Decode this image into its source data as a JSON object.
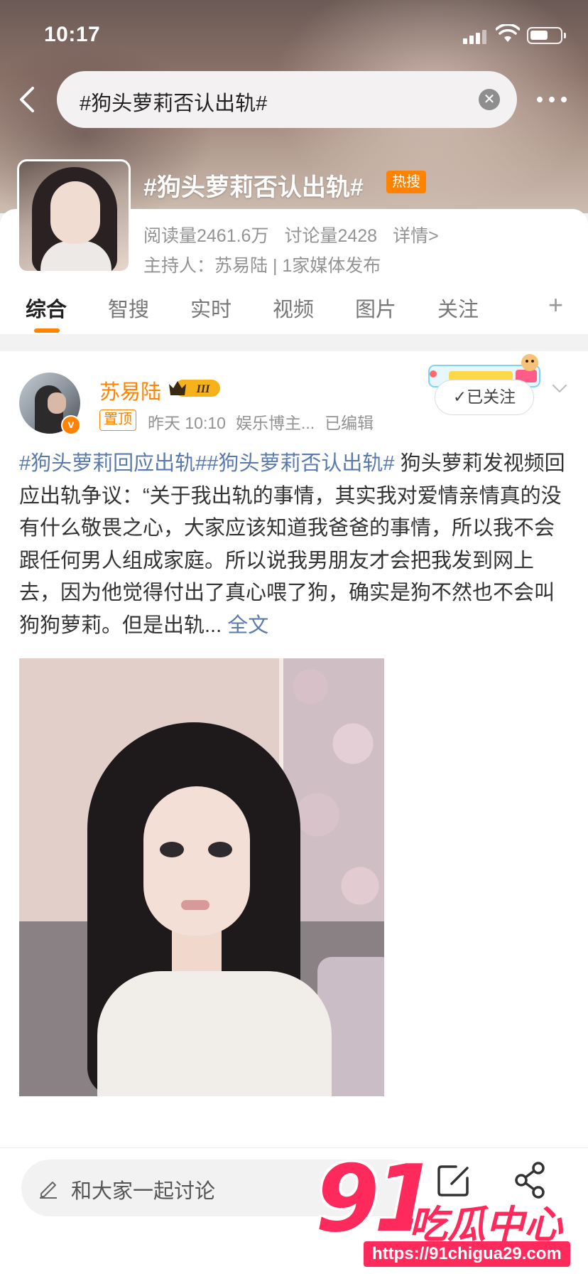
{
  "status_bar": {
    "time": "10:17"
  },
  "search": {
    "query": "#狗头萝莉否认出轨#"
  },
  "topic": {
    "title": "#狗头萝莉否认出轨#",
    "badge": "热搜",
    "reads": "阅读量2461.6万",
    "discussions": "讨论量2428",
    "details_link": "详情>",
    "host": "主持人：苏易陆 | 1家媒体发布"
  },
  "tabs": [
    {
      "label": "综合"
    },
    {
      "label": "智搜"
    },
    {
      "label": "实时"
    },
    {
      "label": "视频"
    },
    {
      "label": "图片"
    },
    {
      "label": "关注"
    }
  ],
  "tabs_add": "+",
  "post": {
    "author": "苏易陆",
    "level_badge": "III",
    "pinned": "置顶",
    "time": "昨天 10:10",
    "source": "娱乐博主...",
    "edited": "已编辑",
    "follow_label": "已关注",
    "hashtag_1": "#狗头萝莉回应出轨#",
    "hashtag_2": "#狗头萝莉否认出轨#",
    "body": " 狗头萝莉发视频回应出轨争议：“关于我出轨的事情，其实我对爱情亲情真的没有什么敬畏之心，大家应该知道我爸爸的事情，所以我不会跟任何男人组成家庭。所以说我男朋友才会把我发到网上去，因为他觉得付出了真心喂了狗，确实是狗不然也不会叫狗狗萝莉。但是出轨...",
    "read_more": "全文"
  },
  "comment_bar": {
    "placeholder": "和大家一起讨论"
  },
  "watermark": {
    "number": "91",
    "text": "吃瓜中心",
    "url": "https://91chigua29.com"
  },
  "colors": {
    "accent": "#ff8200",
    "link": "#5a7aae",
    "watermark": "#ff2a5c"
  }
}
